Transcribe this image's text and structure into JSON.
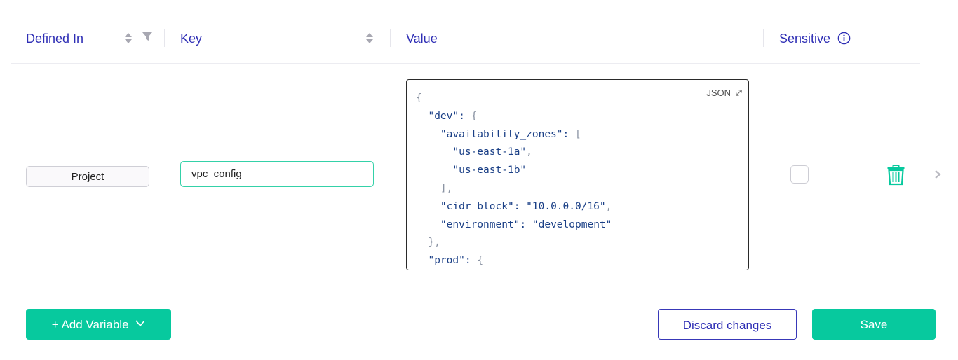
{
  "columns": {
    "defined_in": "Defined In",
    "key": "Key",
    "value": "Value",
    "sensitive": "Sensitive"
  },
  "row": {
    "defined_in": "Project",
    "key": "vpc_config",
    "value_format": "JSON",
    "value_lines": [
      "{",
      "  \"dev\": {",
      "    \"availability_zones\": [",
      "      \"us-east-1a\",",
      "      \"us-east-1b\"",
      "    ],",
      "    \"cidr_block\": \"10.0.0.0/16\",",
      "    \"environment\": \"development\"",
      "  },",
      "  \"prod\": {"
    ],
    "sensitive_checked": false
  },
  "buttons": {
    "add_variable": "+ Add Variable",
    "discard": "Discard changes",
    "save": "Save"
  },
  "icons": {
    "sort": "sort-icon",
    "filter": "filter-icon",
    "info": "info-icon",
    "expand": "expand-icon",
    "delete": "trash-icon",
    "chevron_right": "chevron-right-icon",
    "chevron_down": "chevron-down-icon"
  },
  "colors": {
    "accent": "#07c99e",
    "header_text": "#2f2fb5",
    "code_text": "#1a3f86"
  }
}
